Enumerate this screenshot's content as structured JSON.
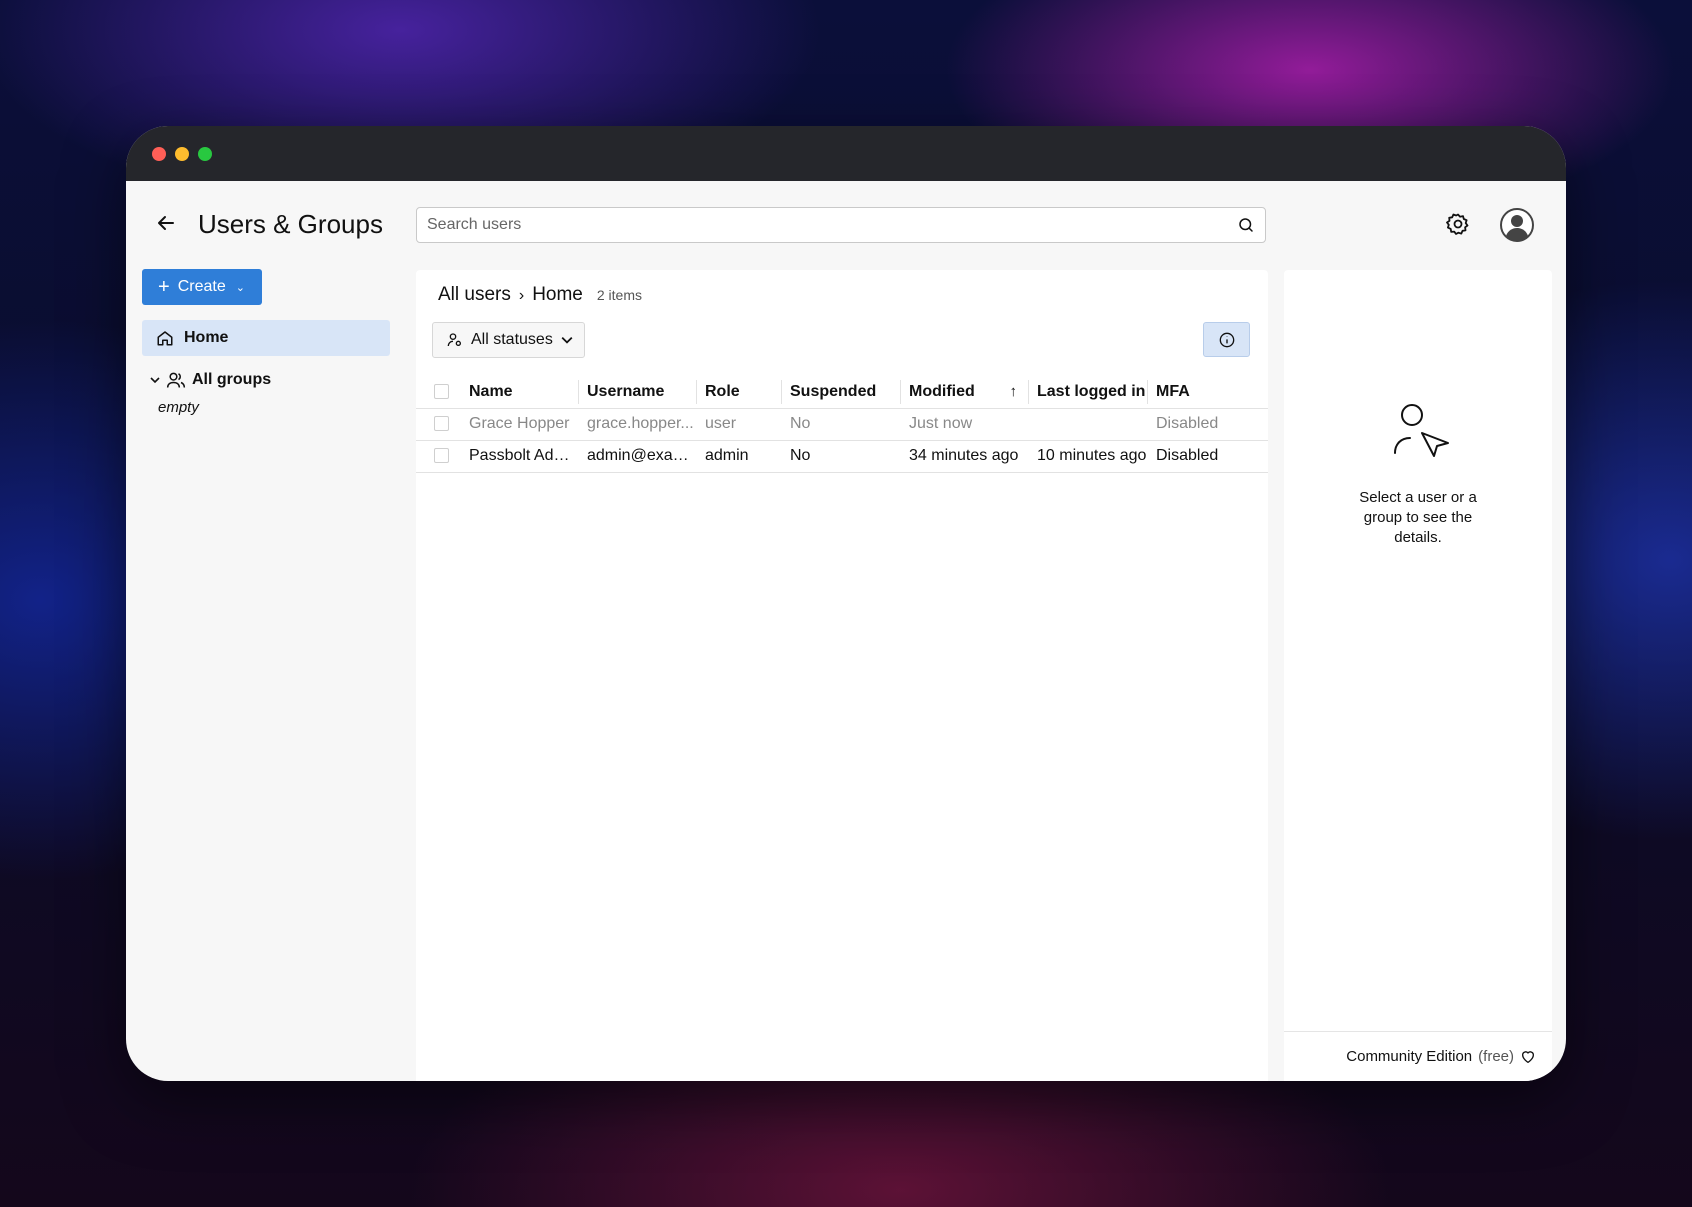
{
  "header": {
    "title": "Users & Groups",
    "search_placeholder": "Search users"
  },
  "sidebar": {
    "create_label": "Create",
    "home_label": "Home",
    "groups_label": "All groups",
    "groups_empty": "empty"
  },
  "main": {
    "breadcrumb": [
      "All users",
      "Home"
    ],
    "item_count": "2 items",
    "status_filter": "All statuses",
    "columns": [
      "Name",
      "Username",
      "Role",
      "Suspended",
      "Modified",
      "Last logged in",
      "MFA"
    ],
    "rows": [
      {
        "name": "Grace Hopper",
        "username": "grace.hopper...",
        "role": "user",
        "suspended": "No",
        "modified": "Just now",
        "last_logged_in": "",
        "mfa": "Disabled"
      },
      {
        "name": "Passbolt Admin",
        "username": "admin@exam...",
        "role": "admin",
        "suspended": "No",
        "modified": "34 minutes ago",
        "last_logged_in": "10 minutes ago",
        "mfa": "Disabled"
      }
    ]
  },
  "details": {
    "empty_text": "Select a user or a group to see the details.",
    "footer_edition": "Community Edition",
    "footer_free": "(free)"
  },
  "icons": [
    "arrow-left-icon",
    "search-icon",
    "gear-icon",
    "avatar-icon",
    "home-icon",
    "users-icon",
    "user-filter-icon",
    "info-icon",
    "sort-up-icon",
    "user-select-icon",
    "heart-icon"
  ],
  "colors": {
    "accent": "#2f7ed8",
    "selected": "#d8e5f7",
    "titlebar": "#25262b"
  }
}
